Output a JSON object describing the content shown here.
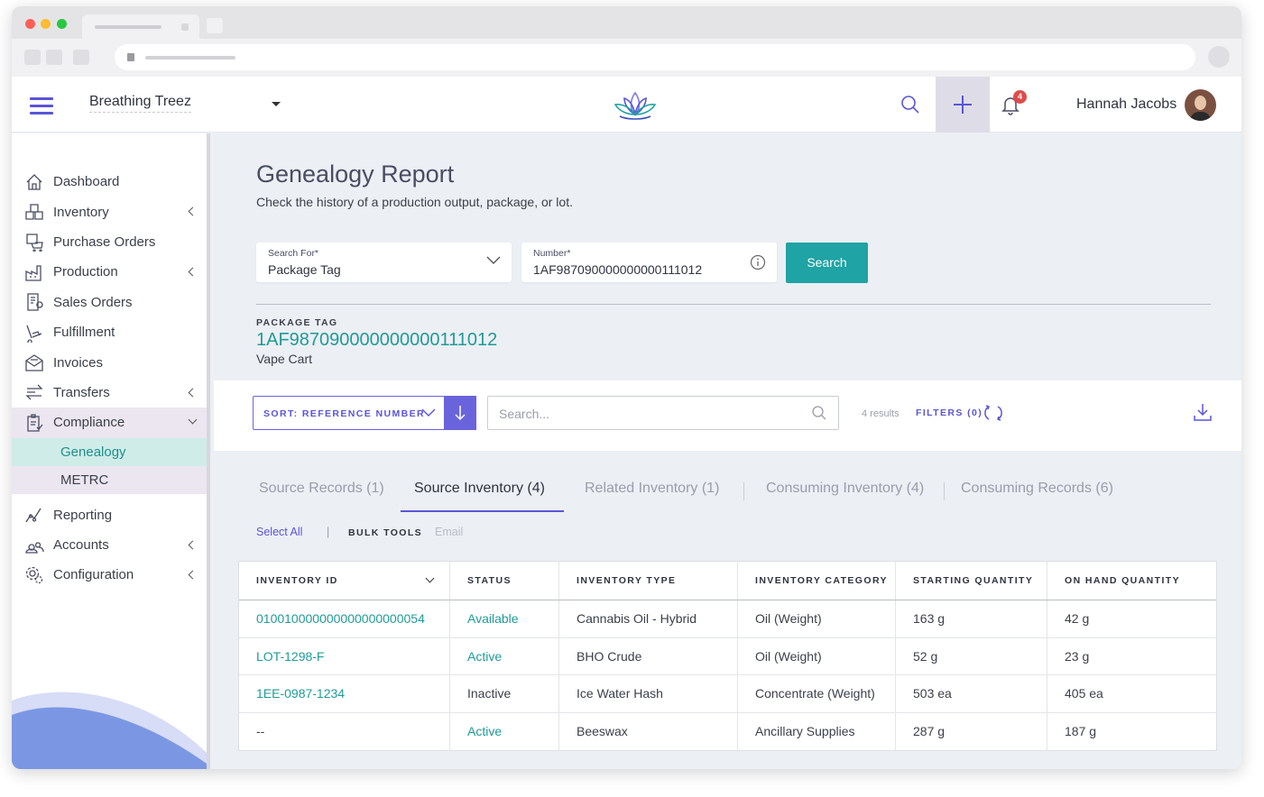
{
  "header": {
    "org_name": "Breathing Treez",
    "user_name": "Hannah Jacobs",
    "notification_count": "4",
    "icons": [
      "menu-icon",
      "lotus-logo",
      "search-icon",
      "plus-icon",
      "bell-icon",
      "avatar"
    ]
  },
  "sidebar": {
    "items": [
      {
        "label": "Dashboard",
        "icon": "home-icon"
      },
      {
        "label": "Inventory",
        "icon": "boxes-icon"
      },
      {
        "label": "Purchase Orders",
        "icon": "cart-icon"
      },
      {
        "label": "Production",
        "icon": "factory-icon"
      },
      {
        "label": "Sales Orders",
        "icon": "receipt-icon"
      },
      {
        "label": "Fulfillment",
        "icon": "dolly-icon"
      },
      {
        "label": "Invoices",
        "icon": "invoice-icon"
      },
      {
        "label": "Transfers",
        "icon": "transfer-icon"
      },
      {
        "label": "Compliance",
        "icon": "clipboard-icon"
      },
      {
        "label": "Reporting",
        "icon": "chart-line-icon"
      },
      {
        "label": "Accounts",
        "icon": "users-icon"
      },
      {
        "label": "Configuration",
        "icon": "gear-icon"
      }
    ],
    "compliance_sub": [
      {
        "label": "Genealogy"
      },
      {
        "label": "METRC"
      }
    ]
  },
  "page": {
    "title": "Genealogy Report",
    "subtitle": "Check the history of a production output, package, or lot.",
    "search_for_label": "Search For*",
    "search_for_value": "Package Tag",
    "number_label": "Number*",
    "number_value": "1AF987090000000000111012",
    "search_button": "Search",
    "package_tag_label": "PACKAGE TAG",
    "package_tag_value": "1AF987090000000000111012",
    "package_tag_sub": "Vape Cart"
  },
  "toolbar": {
    "sort_label": "SORT: REFERENCE NUMBER",
    "search_placeholder": "Search...",
    "results": "4 results",
    "filters": "FILTERS (0)"
  },
  "tabs": [
    {
      "label": "Source Records (1)"
    },
    {
      "label": "Source Inventory (4)"
    },
    {
      "label": "Related Inventory (1)"
    },
    {
      "label": "Consuming Inventory (4)"
    },
    {
      "label": "Consuming Records (6)"
    }
  ],
  "bulk": {
    "select_all": "Select All",
    "separator": "|",
    "bulk_tools": "BULK TOOLS",
    "email": "Email"
  },
  "table": {
    "headers": [
      "INVENTORY ID",
      "STATUS",
      "INVENTORY TYPE",
      "INVENTORY CATEGORY",
      "STARTING QUANTITY",
      "ON HAND QUANTITY"
    ],
    "rows": [
      [
        "010010000000000000000054",
        "Available",
        "Cannabis Oil - Hybrid",
        "Oil (Weight)",
        "163 g",
        "42 g"
      ],
      [
        "LOT-1298-F",
        "Active",
        "BHO Crude",
        "Oil (Weight)",
        "52 g",
        "23 g"
      ],
      [
        "1EE-0987-1234",
        "Inactive",
        "Ice Water Hash",
        "Concentrate (Weight)",
        "503 ea",
        "405 ea"
      ],
      [
        "--",
        "Active",
        "Beeswax",
        "Ancillary Supplies",
        "287 g",
        "187 g"
      ]
    ]
  },
  "colors": {
    "accent": "#5a55d6",
    "teal": "#1fa3a4",
    "badge": "#e04b4b"
  }
}
